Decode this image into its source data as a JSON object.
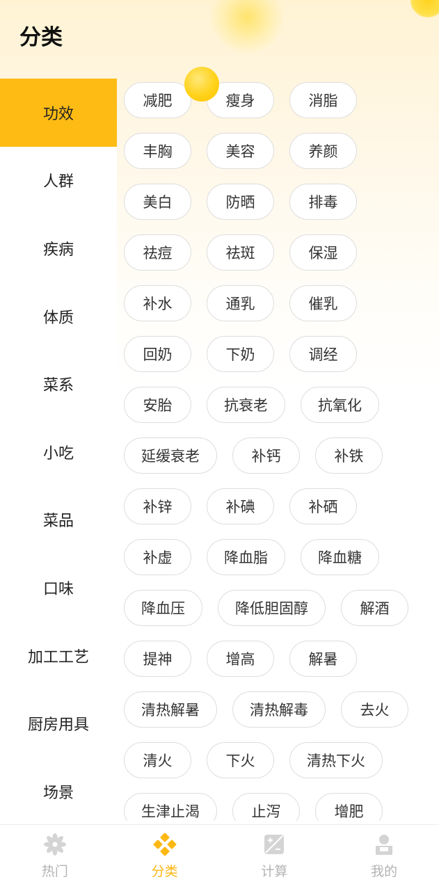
{
  "header": {
    "title": "分类"
  },
  "sidebar": {
    "items": [
      {
        "label": "功效"
      },
      {
        "label": "人群"
      },
      {
        "label": "疾病"
      },
      {
        "label": "体质"
      },
      {
        "label": "菜系"
      },
      {
        "label": "小吃"
      },
      {
        "label": "菜品"
      },
      {
        "label": "口味"
      },
      {
        "label": "加工工艺"
      },
      {
        "label": "厨房用具"
      },
      {
        "label": "场景"
      }
    ],
    "active_index": 0
  },
  "tags": {
    "rows": [
      [
        "减肥",
        "瘦身",
        "消脂"
      ],
      [
        "丰胸",
        "美容",
        "养颜"
      ],
      [
        "美白",
        "防晒",
        "排毒"
      ],
      [
        "祛痘",
        "祛斑",
        "保湿"
      ],
      [
        "补水",
        "通乳",
        "催乳"
      ],
      [
        "回奶",
        "下奶",
        "调经"
      ],
      [
        "安胎",
        "抗衰老",
        "抗氧化"
      ],
      [
        "延缓衰老",
        "补钙",
        "补铁"
      ],
      [
        "补锌",
        "补碘",
        "补硒"
      ],
      [
        "补虚",
        "降血脂",
        "降血糖"
      ],
      [
        "降血压",
        "降低胆固醇",
        "解酒"
      ],
      [
        "提神",
        "增高",
        "解暑"
      ],
      [
        "清热解暑",
        "清热解毒",
        "去火"
      ],
      [
        "清火",
        "下火",
        "清热下火"
      ],
      [
        "生津止渴",
        "止泻",
        "增肥"
      ]
    ]
  },
  "tabbar": {
    "items": [
      {
        "label": "热门",
        "icon": "flower-icon"
      },
      {
        "label": "分类",
        "icon": "diamond-grid-icon"
      },
      {
        "label": "计算",
        "icon": "calculator-icon"
      },
      {
        "label": "我的",
        "icon": "user-icon"
      }
    ],
    "active_index": 1
  },
  "colors": {
    "accent": "#fdbb14",
    "tab_active": "#fdb813",
    "tab_inactive": "#b3b3b3",
    "tag_border": "#dddddd",
    "header_bg": "#fff3d4"
  }
}
